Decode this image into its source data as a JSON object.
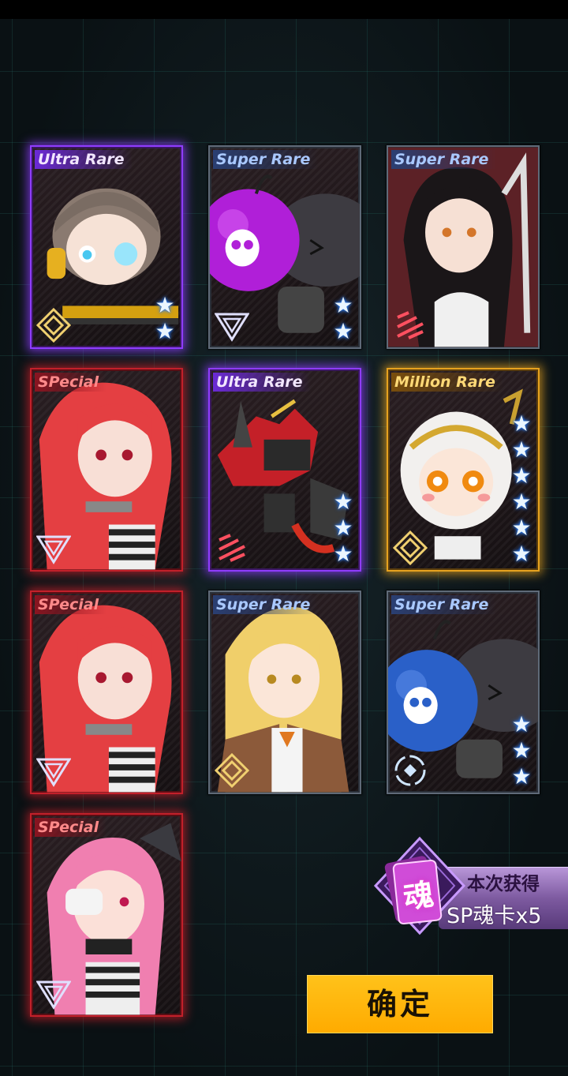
{
  "cards": [
    {
      "rarity": "Ultra Rare",
      "tier": "ur",
      "class_icon": "diamond-class-icon",
      "stars": 2,
      "art": "chibi-gunner"
    },
    {
      "rarity": "Super Rare",
      "tier": "sr",
      "class_icon": "triangle-class-icon",
      "stars": 2,
      "art": "purple-skull-bomb"
    },
    {
      "rarity": "Super Rare",
      "tier": "sr",
      "class_icon": "slash-class-icon",
      "stars": 0,
      "art": "dark-haired-girl"
    },
    {
      "rarity": "SPecial",
      "tier": "sp",
      "class_icon": "triangle-class-icon",
      "stars": 0,
      "art": "red-haired-prisoner"
    },
    {
      "rarity": "Ultra Rare",
      "tier": "ur",
      "class_icon": "slash-class-icon",
      "stars": 3,
      "art": "red-mecha"
    },
    {
      "rarity": "Million Rare",
      "tier": "mr",
      "class_icon": "diamond-class-icon",
      "stars": 6,
      "art": "chibi-white-haired"
    },
    {
      "rarity": "SPecial",
      "tier": "sp",
      "class_icon": "triangle-class-icon",
      "stars": 0,
      "art": "red-haired-prisoner"
    },
    {
      "rarity": "Super Rare",
      "tier": "sr",
      "class_icon": "diamond-class-icon",
      "stars": 0,
      "art": "blonde-girl"
    },
    {
      "rarity": "Super Rare",
      "tier": "sr",
      "class_icon": "circle-class-icon",
      "stars": 3,
      "art": "blue-skull-bomb"
    },
    {
      "rarity": "SPecial",
      "tier": "sp",
      "class_icon": "triangle-class-icon",
      "stars": 0,
      "art": "pink-haired-prisoner"
    }
  ],
  "reward": {
    "icon_char": "魂",
    "title": "本次获得",
    "count": "SP魂卡x5"
  },
  "confirm_label": "确定",
  "colors": {
    "ultra_rare": "#8f3cff",
    "super_rare": "#5f6a78",
    "million_rare": "#e6a21f",
    "special": "#c2202a",
    "confirm_button": "#ffb300",
    "star_glow": "#2a7fff"
  }
}
